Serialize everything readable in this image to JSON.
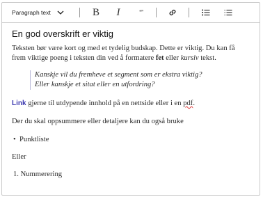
{
  "toolbar": {
    "paragraph_style": "Paragraph text",
    "bold_label": "B",
    "italic_label": "I",
    "quote_label": "“”"
  },
  "content": {
    "heading": "En god overskrift er viktig",
    "intro_part1": "Teksten bør være kort og med et tydelig budskap. Dette er viktig. Du kan få frem viktige poeng i teksten din ved å formatere ",
    "intro_bold": "fet",
    "intro_mid": " eller ",
    "intro_italic": "kursiv",
    "intro_end": " tekst.",
    "quote_line1": "Kanskje vil du fremheve et segment som er ekstra viktig?",
    "quote_line2": "Eller kanskje et sitat eller en utfordring?",
    "link_text": "Link",
    "link_rest": " gjerne til utdypende innhold på en nettside eller i en ",
    "link_pdf": "pdf",
    "link_end": ".",
    "summary": "Der du skal oppsummere eller detaljere kan du også bruke",
    "bullet_marker": "•",
    "bullet_item": "Punktliste",
    "or_text": "Eller",
    "number_marker": "1.",
    "number_item": "Nummerering"
  }
}
